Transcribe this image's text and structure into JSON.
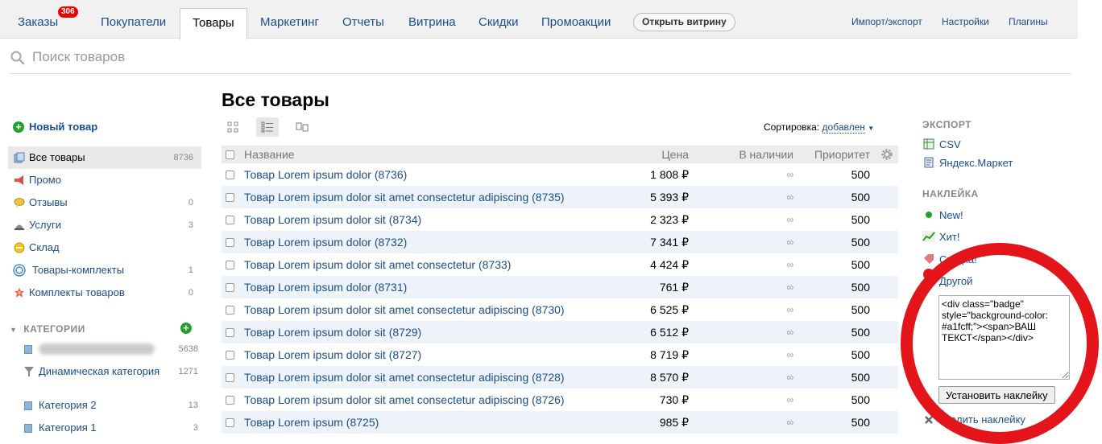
{
  "nav": {
    "tabs": [
      {
        "label": "Заказы",
        "badge": "306"
      },
      {
        "label": "Покупатели"
      },
      {
        "label": "Товары",
        "active": true
      },
      {
        "label": "Маркетинг"
      },
      {
        "label": "Отчеты"
      },
      {
        "label": "Витрина"
      },
      {
        "label": "Скидки"
      },
      {
        "label": "Промоакции"
      }
    ],
    "open_store_label": "Открыть витрину",
    "right_links": [
      "Импорт/экспорт",
      "Настройки",
      "Плагины"
    ]
  },
  "search": {
    "placeholder": "Поиск товаров"
  },
  "sidebar": {
    "new_item_label": "Новый товар",
    "items": [
      {
        "label": "Все товары",
        "count": "8736",
        "icon": "products-icon",
        "active": true
      },
      {
        "label": "Промо",
        "count": "",
        "icon": "megaphone-icon"
      },
      {
        "label": "Отзывы",
        "count": "0",
        "icon": "reviews-icon"
      },
      {
        "label": "Услуги",
        "count": "3",
        "icon": "services-icon"
      },
      {
        "label": "Склад",
        "count": "",
        "icon": "stock-icon"
      },
      {
        "label": "Товары-комплекты",
        "count": "1",
        "icon": "bundles-icon"
      },
      {
        "label": "Комплекты товаров",
        "count": "0",
        "icon": "sets-icon"
      }
    ],
    "categories_heading": "КАТЕГОРИИ",
    "categories": [
      {
        "label": "",
        "count": "5638",
        "blurred": true
      },
      {
        "label": "Динамическая категория",
        "count": "1271",
        "dynamic": true
      },
      {
        "label": "Категория 2",
        "count": "13"
      },
      {
        "label": "Категория 1",
        "count": "3"
      }
    ]
  },
  "main": {
    "title": "Все товары",
    "sort_label": "Сортировка:",
    "sort_value": "добавлен",
    "columns": {
      "name": "Название",
      "price": "Цена",
      "stock": "В наличии",
      "priority": "Приоритет"
    },
    "rows": [
      {
        "name": "Товар Lorem ipsum dolor (8736)",
        "price": "1 808 ₽",
        "stock": "∞",
        "priority": "500"
      },
      {
        "name": "Товар Lorem ipsum dolor sit amet consectetur adipiscing (8735)",
        "price": "5 393 ₽",
        "stock": "∞",
        "priority": "500"
      },
      {
        "name": "Товар Lorem ipsum dolor sit (8734)",
        "price": "2 323 ₽",
        "stock": "∞",
        "priority": "500"
      },
      {
        "name": "Товар Lorem ipsum dolor (8732)",
        "price": "7 341 ₽",
        "stock": "∞",
        "priority": "500"
      },
      {
        "name": "Товар Lorem ipsum dolor sit amet consectetur (8733)",
        "price": "4 424 ₽",
        "stock": "∞",
        "priority": "500"
      },
      {
        "name": "Товар Lorem ipsum dolor (8731)",
        "price": "761 ₽",
        "stock": "∞",
        "priority": "500"
      },
      {
        "name": "Товар Lorem ipsum dolor sit amet consectetur adipiscing (8730)",
        "price": "6 525 ₽",
        "stock": "∞",
        "priority": "500"
      },
      {
        "name": "Товар Lorem ipsum dolor sit (8729)",
        "price": "6 512 ₽",
        "stock": "∞",
        "priority": "500"
      },
      {
        "name": "Товар Lorem ipsum dolor sit (8727)",
        "price": "8 719 ₽",
        "stock": "∞",
        "priority": "500"
      },
      {
        "name": "Товар Lorem ipsum dolor sit amet consectetur adipiscing (8728)",
        "price": "8 570 ₽",
        "stock": "∞",
        "priority": "500"
      },
      {
        "name": "Товар Lorem ipsum dolor sit amet consectetur adipiscing (8726)",
        "price": "730 ₽",
        "stock": "∞",
        "priority": "500"
      },
      {
        "name": "Товар Lorem ipsum (8725)",
        "price": "985 ₽",
        "stock": "∞",
        "priority": "500"
      }
    ]
  },
  "right": {
    "export_heading": "ЭКСПОРТ",
    "export_links": [
      "CSV",
      "Яндекс.Маркет"
    ],
    "badge_heading": "НАКЛЕЙКА",
    "badge_options": [
      "New!",
      "Хит!",
      "Скидка!",
      "Другой"
    ],
    "badge_code": "<div class=\"badge\" style=\"background-color: #a1fcff;\"><span>ВАШ ТЕКСТ</span></div>",
    "set_badge_label": "Установить наклейку",
    "remove_badge_label": "Удалить наклейку"
  },
  "colors": {
    "accent": "#1a4d8c",
    "badge_red": "#e00000",
    "highlight_ring": "#e3151b",
    "add_green": "#22a12a"
  }
}
